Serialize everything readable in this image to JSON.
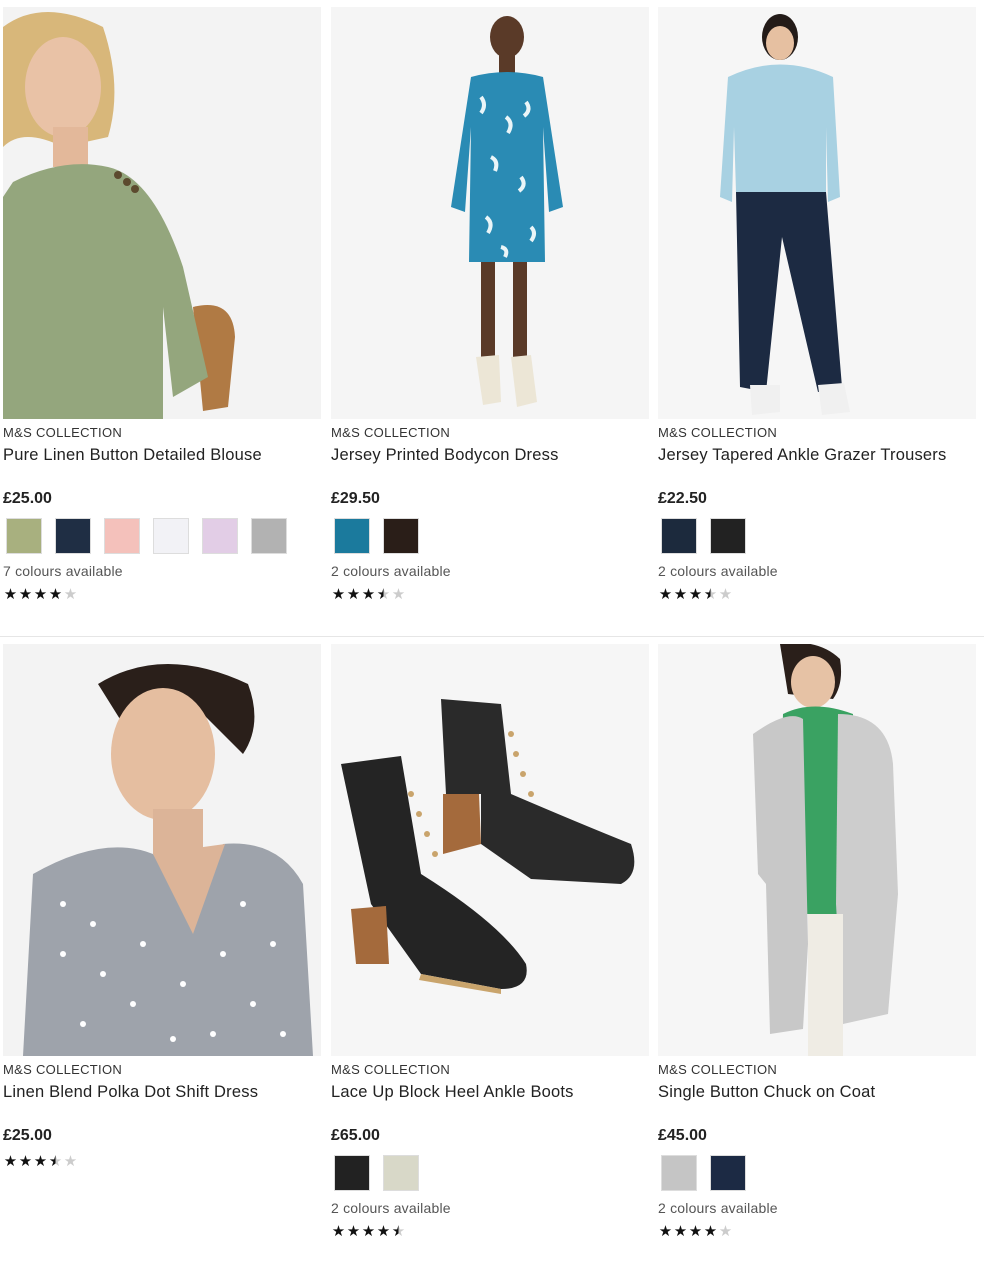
{
  "products": [
    {
      "brand": "M&S COLLECTION",
      "name": "Pure Linen Button Detailed Blouse",
      "price": "£25.00",
      "swatches": [
        "#a8b07f",
        "#1f2e44",
        "#f4c1bb",
        "#f2f2f6",
        "#e2cde6",
        "#b2b2b2"
      ],
      "colours_text": "7 colours available",
      "rating": 4,
      "image": "green-linen-blouse"
    },
    {
      "brand": "M&S COLLECTION",
      "name": "Jersey Printed Bodycon Dress",
      "price": "£29.50",
      "swatches": [
        "#1b7a9d",
        "#2a1e18"
      ],
      "colours_text": "2 colours available",
      "rating": 3.5,
      "image": "blue-printed-dress"
    },
    {
      "brand": "M&S COLLECTION",
      "name": "Jersey Tapered Ankle Grazer Trousers",
      "price": "£22.50",
      "swatches": [
        "#1c2a3d",
        "#222222"
      ],
      "colours_text": "2 colours available",
      "rating": 3.5,
      "image": "navy-trousers"
    },
    {
      "brand": "M&S COLLECTION",
      "name": "Linen Blend Polka Dot Shift Dress",
      "price": "£25.00",
      "swatches": [],
      "colours_text": "",
      "rating": 3.5,
      "image": "grey-polka-dress"
    },
    {
      "brand": "M&S COLLECTION",
      "name": "Lace Up Block Heel Ankle Boots",
      "price": "£65.00",
      "swatches": [
        "#222222",
        "#d8d8c8"
      ],
      "colours_text": "2 colours available",
      "rating": 4.5,
      "image": "black-ankle-boots"
    },
    {
      "brand": "M&S COLLECTION",
      "name": "Single Button Chuck on Coat",
      "price": "£45.00",
      "swatches": [
        "#c5c5c5",
        "#1c2a44"
      ],
      "colours_text": "2 colours available",
      "rating": 4,
      "image": "grey-coat"
    }
  ]
}
